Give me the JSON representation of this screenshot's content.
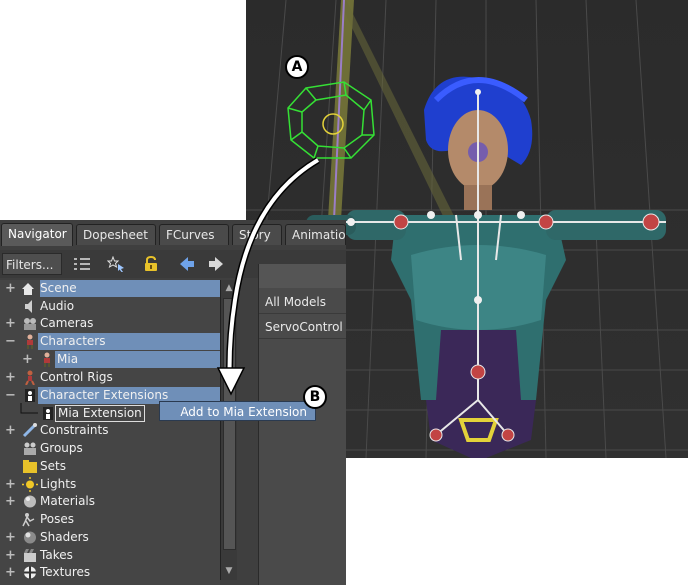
{
  "tabs": [
    "Navigator",
    "Dopesheet",
    "FCurves",
    "Story",
    "Animation"
  ],
  "toolbar": {
    "filters_label": "Filters..."
  },
  "tree": [
    {
      "label": "Scene",
      "toggle": "+",
      "icon": "scene-icon",
      "selected": true
    },
    {
      "label": "Audio",
      "toggle": "",
      "icon": "audio-icon",
      "selected": false
    },
    {
      "label": "Cameras",
      "toggle": "+",
      "icon": "camera-icon",
      "selected": false
    },
    {
      "label": "Characters",
      "toggle": "−",
      "icon": "character-icon",
      "selected": true
    },
    {
      "label": "Mia",
      "toggle": "+",
      "icon": "character-icon",
      "selected": true
    },
    {
      "label": "Control Rigs",
      "toggle": "+",
      "icon": "control-rig-icon",
      "selected": false
    },
    {
      "label": "Character Extensions",
      "toggle": "−",
      "icon": "extension-icon",
      "selected": true
    },
    {
      "label": "Mia Extension",
      "toggle": "",
      "icon": "extension-icon",
      "selected": false
    },
    {
      "label": "Constraints",
      "toggle": "+",
      "icon": "constraint-icon",
      "selected": false
    },
    {
      "label": "Groups",
      "toggle": "",
      "icon": "groups-icon",
      "selected": false
    },
    {
      "label": "Sets",
      "toggle": "",
      "icon": "sets-icon",
      "selected": false
    },
    {
      "label": "Lights",
      "toggle": "+",
      "icon": "light-icon",
      "selected": false
    },
    {
      "label": "Materials",
      "toggle": "+",
      "icon": "material-icon",
      "selected": false
    },
    {
      "label": "Poses",
      "toggle": "",
      "icon": "pose-icon",
      "selected": false
    },
    {
      "label": "Shaders",
      "toggle": "+",
      "icon": "shader-icon",
      "selected": false
    },
    {
      "label": "Takes",
      "toggle": "+",
      "icon": "takes-icon",
      "selected": false
    },
    {
      "label": "Textures",
      "toggle": "+",
      "icon": "texture-icon",
      "selected": false
    }
  ],
  "right_pane": {
    "rows": [
      "All Models",
      "ServoControl"
    ]
  },
  "context_menu": {
    "item": "Add to Mia Extension"
  },
  "callouts": {
    "a": "A",
    "b": "B"
  },
  "colors": {
    "selection": "#6f8fb8",
    "panel": "#3f3f3f",
    "viewport_bg": "#2b2b2b"
  }
}
